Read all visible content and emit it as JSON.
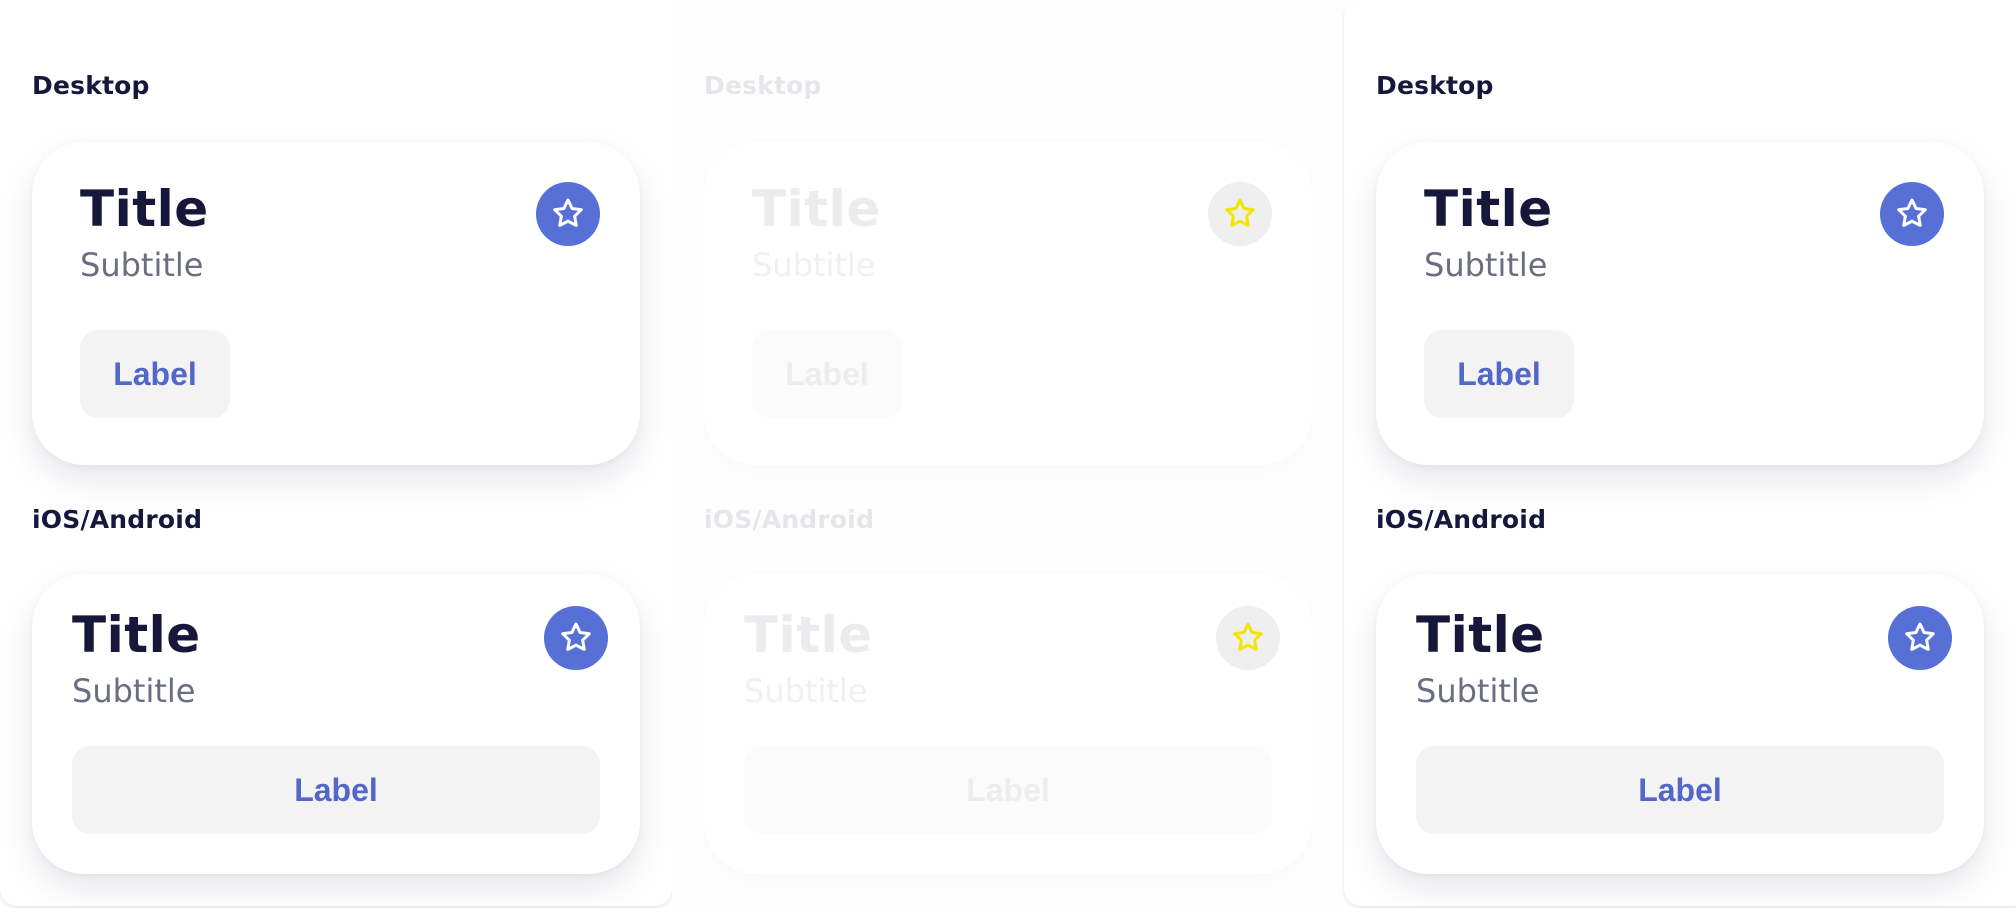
{
  "colors": {
    "accent": "#5670d6",
    "label_text": "#5267c9",
    "title_text": "#16173a",
    "subtitle_text": "#6b6e80",
    "button_bg": "#f3f3f4",
    "disabled_star_stroke": "#f2e600"
  },
  "icons": {
    "favorite": "star-icon"
  },
  "columns": [
    {
      "state": "default",
      "desktop": {
        "section_label": "Desktop",
        "title": "Title",
        "subtitle": "Subtitle",
        "button_label": "Label"
      },
      "mobile": {
        "section_label": "iOS/Android",
        "title": "Title",
        "subtitle": "Subtitle",
        "button_label": "Label"
      }
    },
    {
      "state": "disabled",
      "desktop": {
        "section_label": "Desktop",
        "title": "Title",
        "subtitle": "Subtitle",
        "button_label": "Label"
      },
      "mobile": {
        "section_label": "iOS/Android",
        "title": "Title",
        "subtitle": "Subtitle",
        "button_label": "Label"
      }
    },
    {
      "state": "default",
      "desktop": {
        "section_label": "Desktop",
        "title": "Title",
        "subtitle": "Subtitle",
        "button_label": "Label"
      },
      "mobile": {
        "section_label": "iOS/Android",
        "title": "Title",
        "subtitle": "Subtitle",
        "button_label": "Label"
      }
    }
  ]
}
